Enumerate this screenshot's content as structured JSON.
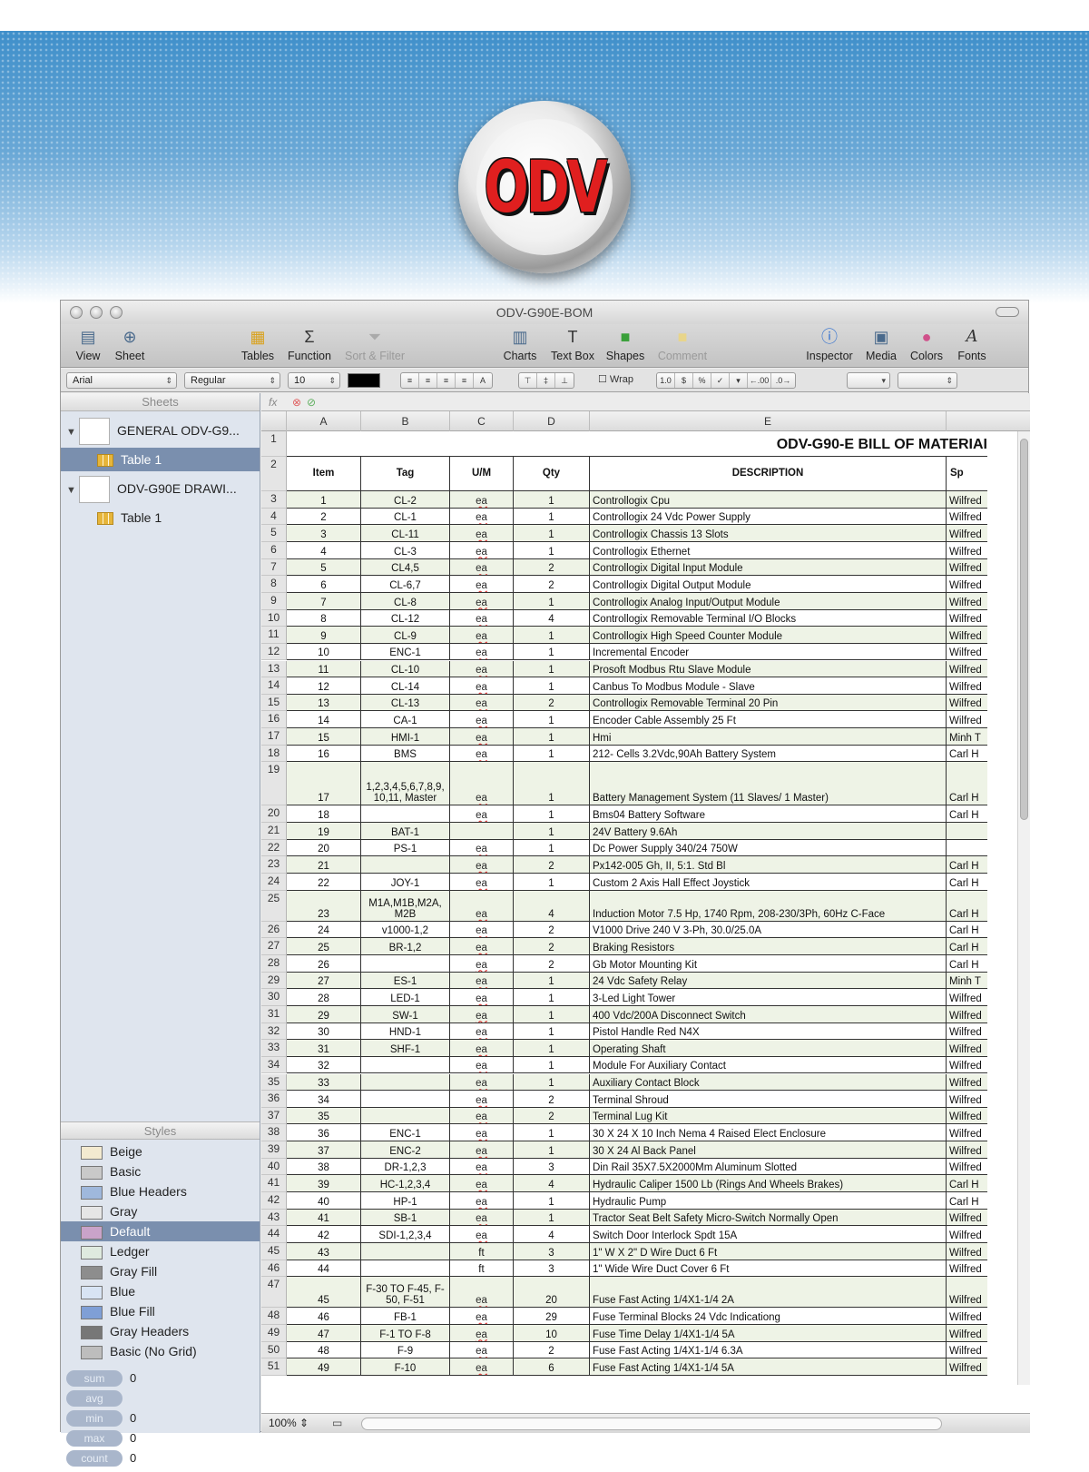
{
  "logo": {
    "text": "ODV"
  },
  "window": {
    "title": "ODV-G90E-BOM"
  },
  "toolbar": {
    "view": "View",
    "sheet": "Sheet",
    "tables": "Tables",
    "function": "Function",
    "sort_filter": "Sort & Filter",
    "charts": "Charts",
    "text_box": "Text Box",
    "shapes": "Shapes",
    "comment": "Comment",
    "inspector": "Inspector",
    "media": "Media",
    "colors": "Colors",
    "fonts": "Fonts"
  },
  "format": {
    "font": "Arial",
    "weight": "Regular",
    "size": "10",
    "wrap": "Wrap",
    "number_buttons": [
      "1.0",
      "$",
      "%",
      "✓",
      "▾",
      "←.00",
      ".0→"
    ]
  },
  "sidebar": {
    "sheets_header": "Sheets",
    "doc1": "GENERAL ODV-G9...",
    "doc1_table": "Table 1",
    "doc2": "ODV-G90E DRAWI...",
    "doc2_table": "Table 1",
    "styles_header": "Styles",
    "styles": [
      {
        "name": "Beige",
        "color": "#f3ead0"
      },
      {
        "name": "Basic",
        "color": "#c9c9c9"
      },
      {
        "name": "Blue Headers",
        "color": "#9fb8dc"
      },
      {
        "name": "Gray",
        "color": "#e6e6e6"
      },
      {
        "name": "Default",
        "color": "#c9a3c9"
      },
      {
        "name": "Ledger",
        "color": "#dfeadf"
      },
      {
        "name": "Gray Fill",
        "color": "#8d8d8d"
      },
      {
        "name": "Blue",
        "color": "#d8e4f4"
      },
      {
        "name": "Blue Fill",
        "color": "#7f9fd6"
      },
      {
        "name": "Gray Headers",
        "color": "#777777"
      },
      {
        "name": "Basic (No Grid)",
        "color": "#bdbdbd"
      }
    ],
    "stats": [
      {
        "label": "sum",
        "value": "0"
      },
      {
        "label": "avg",
        "value": ""
      },
      {
        "label": "min",
        "value": "0"
      },
      {
        "label": "max",
        "value": "0"
      },
      {
        "label": "count",
        "value": "0"
      }
    ]
  },
  "sheet": {
    "fx": "fx",
    "columns": [
      "A",
      "B",
      "C",
      "D",
      "E"
    ],
    "title": "ODV-G90-E BILL OF MATERIAI",
    "headers": [
      "Item",
      "Tag",
      "U/M",
      "Qty",
      "DESCRIPTION",
      "Sp"
    ],
    "rows": [
      [
        "3",
        "1",
        "CL-2",
        "ea",
        "1",
        "Controllogix Cpu",
        "Wilfred"
      ],
      [
        "4",
        "2",
        "CL-1",
        "ea",
        "1",
        "Controllogix 24 Vdc Power Supply",
        "Wilfred"
      ],
      [
        "5",
        "3",
        "CL-11",
        "ea",
        "1",
        "Controllogix Chassis 13 Slots",
        "Wilfred"
      ],
      [
        "6",
        "4",
        "CL-3",
        "ea",
        "1",
        "Controllogix Ethernet",
        "Wilfred"
      ],
      [
        "7",
        "5",
        "CL4,5",
        "ea",
        "2",
        "Controllogix Digital Input Module",
        "Wilfred"
      ],
      [
        "8",
        "6",
        "CL-6,7",
        "ea",
        "2",
        "Controllogix Digital Output Module",
        "Wilfred"
      ],
      [
        "9",
        "7",
        "CL-8",
        "ea",
        "1",
        "Controllogix Analog Input/Output Module",
        "Wilfred"
      ],
      [
        "10",
        "8",
        "CL-12",
        "ea",
        "4",
        "Controllogix Removable Terminal I/O Blocks",
        "Wilfred"
      ],
      [
        "11",
        "9",
        "CL-9",
        "ea",
        "1",
        "Controllogix High Speed Counter Module",
        "Wilfred"
      ],
      [
        "12",
        "10",
        "ENC-1",
        "ea",
        "1",
        "Incremental Encoder",
        "Wilfred"
      ],
      [
        "13",
        "11",
        "CL-10",
        "ea",
        "1",
        "Prosoft Modbus Rtu Slave Module",
        "Wilfred"
      ],
      [
        "14",
        "12",
        "CL-14",
        "ea",
        "1",
        "Canbus To Modbus Module - Slave",
        "Wilfred"
      ],
      [
        "15",
        "13",
        "CL-13",
        "ea",
        "2",
        "Controllogix Removable Terminal 20 Pin",
        "Wilfred"
      ],
      [
        "16",
        "14",
        "CA-1",
        "ea",
        "1",
        "Encoder Cable Assembly 25 Ft",
        "Wilfred"
      ],
      [
        "17",
        "15",
        "HMI-1",
        "ea",
        "1",
        "Hmi",
        "Minh T"
      ],
      [
        "18",
        "16",
        "BMS",
        "ea",
        "1",
        "212- Cells 3.2Vdc,90Ah Battery System",
        "Carl H"
      ],
      [
        "19",
        "17",
        "1,2,3,4,5,6,7,8,9, 10,11, Master",
        "ea",
        "1",
        "Battery Management System (11 Slaves/ 1 Master)",
        "Carl H"
      ],
      [
        "20",
        "18",
        "",
        "ea",
        "1",
        "Bms04 Battery Software",
        "Carl H"
      ],
      [
        "21",
        "19",
        "BAT-1",
        "",
        "1",
        "24V Battery 9.6Ah",
        ""
      ],
      [
        "22",
        "20",
        "PS-1",
        "ea",
        "1",
        "Dc Power Supply 340/24 750W",
        ""
      ],
      [
        "23",
        "21",
        "",
        "ea",
        "2",
        "Px142-005 Gh, II, 5:1. Std Bl",
        "Carl H"
      ],
      [
        "24",
        "22",
        "JOY-1",
        "ea",
        "1",
        "Custom 2 Axis Hall Effect Joystick",
        "Carl H"
      ],
      [
        "25",
        "23",
        "M1A,M1B,M2A, M2B",
        "ea",
        "4",
        "Induction Motor 7.5 Hp, 1740 Rpm, 208-230/3Ph, 60Hz C-Face",
        "Carl H"
      ],
      [
        "26",
        "24",
        "v1000-1,2",
        "ea",
        "2",
        "V1000 Drive 240 V 3-Ph, 30.0/25.0A",
        "Carl H"
      ],
      [
        "27",
        "25",
        "BR-1,2",
        "ea",
        "2",
        "Braking Resistors",
        "Carl H"
      ],
      [
        "28",
        "26",
        "",
        "ea",
        "2",
        "Gb Motor Mounting Kit",
        "Carl H"
      ],
      [
        "29",
        "27",
        "ES-1",
        "ea",
        "1",
        "24 Vdc Safety Relay",
        "Minh T"
      ],
      [
        "30",
        "28",
        "LED-1",
        "ea",
        "1",
        "3-Led Light Tower",
        "Wilfred"
      ],
      [
        "31",
        "29",
        "SW-1",
        "ea",
        "1",
        "400 Vdc/200A Disconnect Switch",
        "Wilfred"
      ],
      [
        "32",
        "30",
        "HND-1",
        "ea",
        "1",
        "Pistol Handle Red N4X",
        "Wilfred"
      ],
      [
        "33",
        "31",
        "SHF-1",
        "ea",
        "1",
        "Operating Shaft",
        "Wilfred"
      ],
      [
        "34",
        "32",
        "",
        "ea",
        "1",
        "Module For Auxiliary Contact",
        "Wilfred"
      ],
      [
        "35",
        "33",
        "",
        "ea",
        "1",
        "Auxiliary Contact Block",
        "Wilfred"
      ],
      [
        "36",
        "34",
        "",
        "ea",
        "2",
        "Terminal Shroud",
        "Wilfred"
      ],
      [
        "37",
        "35",
        "",
        "ea",
        "2",
        "Terminal Lug Kit",
        "Wilfred"
      ],
      [
        "38",
        "36",
        "ENC-1",
        "ea",
        "1",
        "30 X 24 X 10 Inch Nema 4 Raised Elect Enclosure",
        "Wilfred"
      ],
      [
        "39",
        "37",
        "ENC-2",
        "ea",
        "1",
        "30 X 24 Al Back Panel",
        "Wilfred"
      ],
      [
        "40",
        "38",
        "DR-1,2,3",
        "ea",
        "3",
        "Din Rail 35X7.5X2000Mm Aluminum Slotted",
        "Wilfred"
      ],
      [
        "41",
        "39",
        "HC-1,2,3,4",
        "ea",
        "4",
        "Hydraulic Caliper 1500 Lb (Rings And Wheels Brakes)",
        "Carl H"
      ],
      [
        "42",
        "40",
        "HP-1",
        "ea",
        "1",
        "Hydraulic Pump",
        "Carl H"
      ],
      [
        "43",
        "41",
        "SB-1",
        "ea",
        "1",
        "Tractor Seat Belt Safety Micro-Switch Normally Open",
        "Wilfred"
      ],
      [
        "44",
        "42",
        "SDI-1,2,3,4",
        "ea",
        "4",
        "Switch Door Interlock Spdt 15A",
        "Wilfred"
      ],
      [
        "45",
        "43",
        "",
        "ft",
        "3",
        "1\" W X 2\" D Wire Duct 6 Ft",
        "Wilfred"
      ],
      [
        "46",
        "44",
        "",
        "ft",
        "3",
        "1\" Wide Wire Duct Cover 6 Ft",
        "Wilfred"
      ],
      [
        "47",
        "45",
        "F-30 TO F-45, F-50, F-51",
        "ea",
        "20",
        "Fuse Fast Acting 1/4X1-1/4 2A",
        "Wilfred"
      ],
      [
        "48",
        "46",
        "FB-1",
        "ea",
        "29",
        "Fuse Terminal Blocks 24 Vdc Indicationg",
        "Wilfred"
      ],
      [
        "49",
        "47",
        "F-1 TO F-8",
        "ea",
        "10",
        "Fuse Time Delay 1/4X1-1/4 5A",
        "Wilfred"
      ],
      [
        "50",
        "48",
        "F-9",
        "ea",
        "2",
        "Fuse Fast Acting  1/4X1-1/4 6.3A",
        "Wilfred"
      ],
      [
        "51",
        "49",
        "F-10",
        "ea",
        "6",
        "Fuse Fast Acting 1/4X1-1/4 5A",
        "Wilfred"
      ]
    ],
    "zoom": "100%"
  }
}
